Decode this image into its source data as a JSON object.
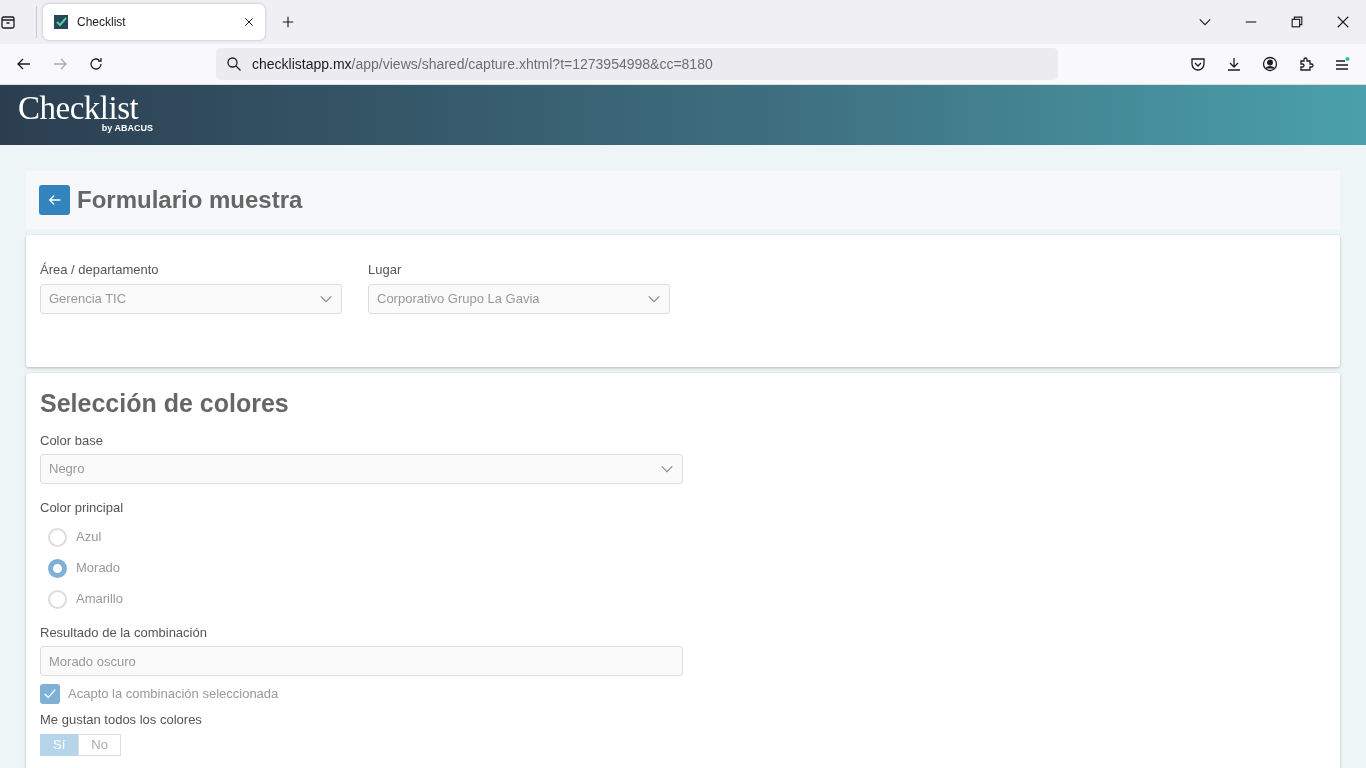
{
  "browser": {
    "tab": {
      "title": "Checklist",
      "selected": true
    },
    "url": {
      "host": "checklistapp.mx",
      "path": "/app/views/shared/capture.xhtml?t=1273954998&cc=8180"
    }
  },
  "header": {
    "logo": "Checklist",
    "logo_sub": "by ABACUS"
  },
  "page_title": "Formulario muestra",
  "location_card": {
    "fields": [
      {
        "label": "Área / departamento",
        "value": "Gerencia TIC"
      },
      {
        "label": "Lugar",
        "value": "Corporativo Grupo La Gavia"
      }
    ]
  },
  "colors_section": {
    "title": "Selección de colores",
    "base": {
      "label": "Color base",
      "value": "Negro"
    },
    "principal": {
      "label": "Color principal",
      "options": [
        {
          "label": "Azul",
          "selected": false
        },
        {
          "label": "Morado",
          "selected": true
        },
        {
          "label": "Amarillo",
          "selected": false
        }
      ]
    },
    "result": {
      "label": "Resultado de la combinación",
      "value": "Morado oscuro"
    },
    "accept": {
      "label": "Acapto la combinación seleccionada",
      "checked": true
    },
    "likes": {
      "label": "Me gustan todos los colores",
      "options": [
        {
          "label": "Sí",
          "selected": true
        },
        {
          "label": "No",
          "selected": false
        }
      ]
    }
  }
}
